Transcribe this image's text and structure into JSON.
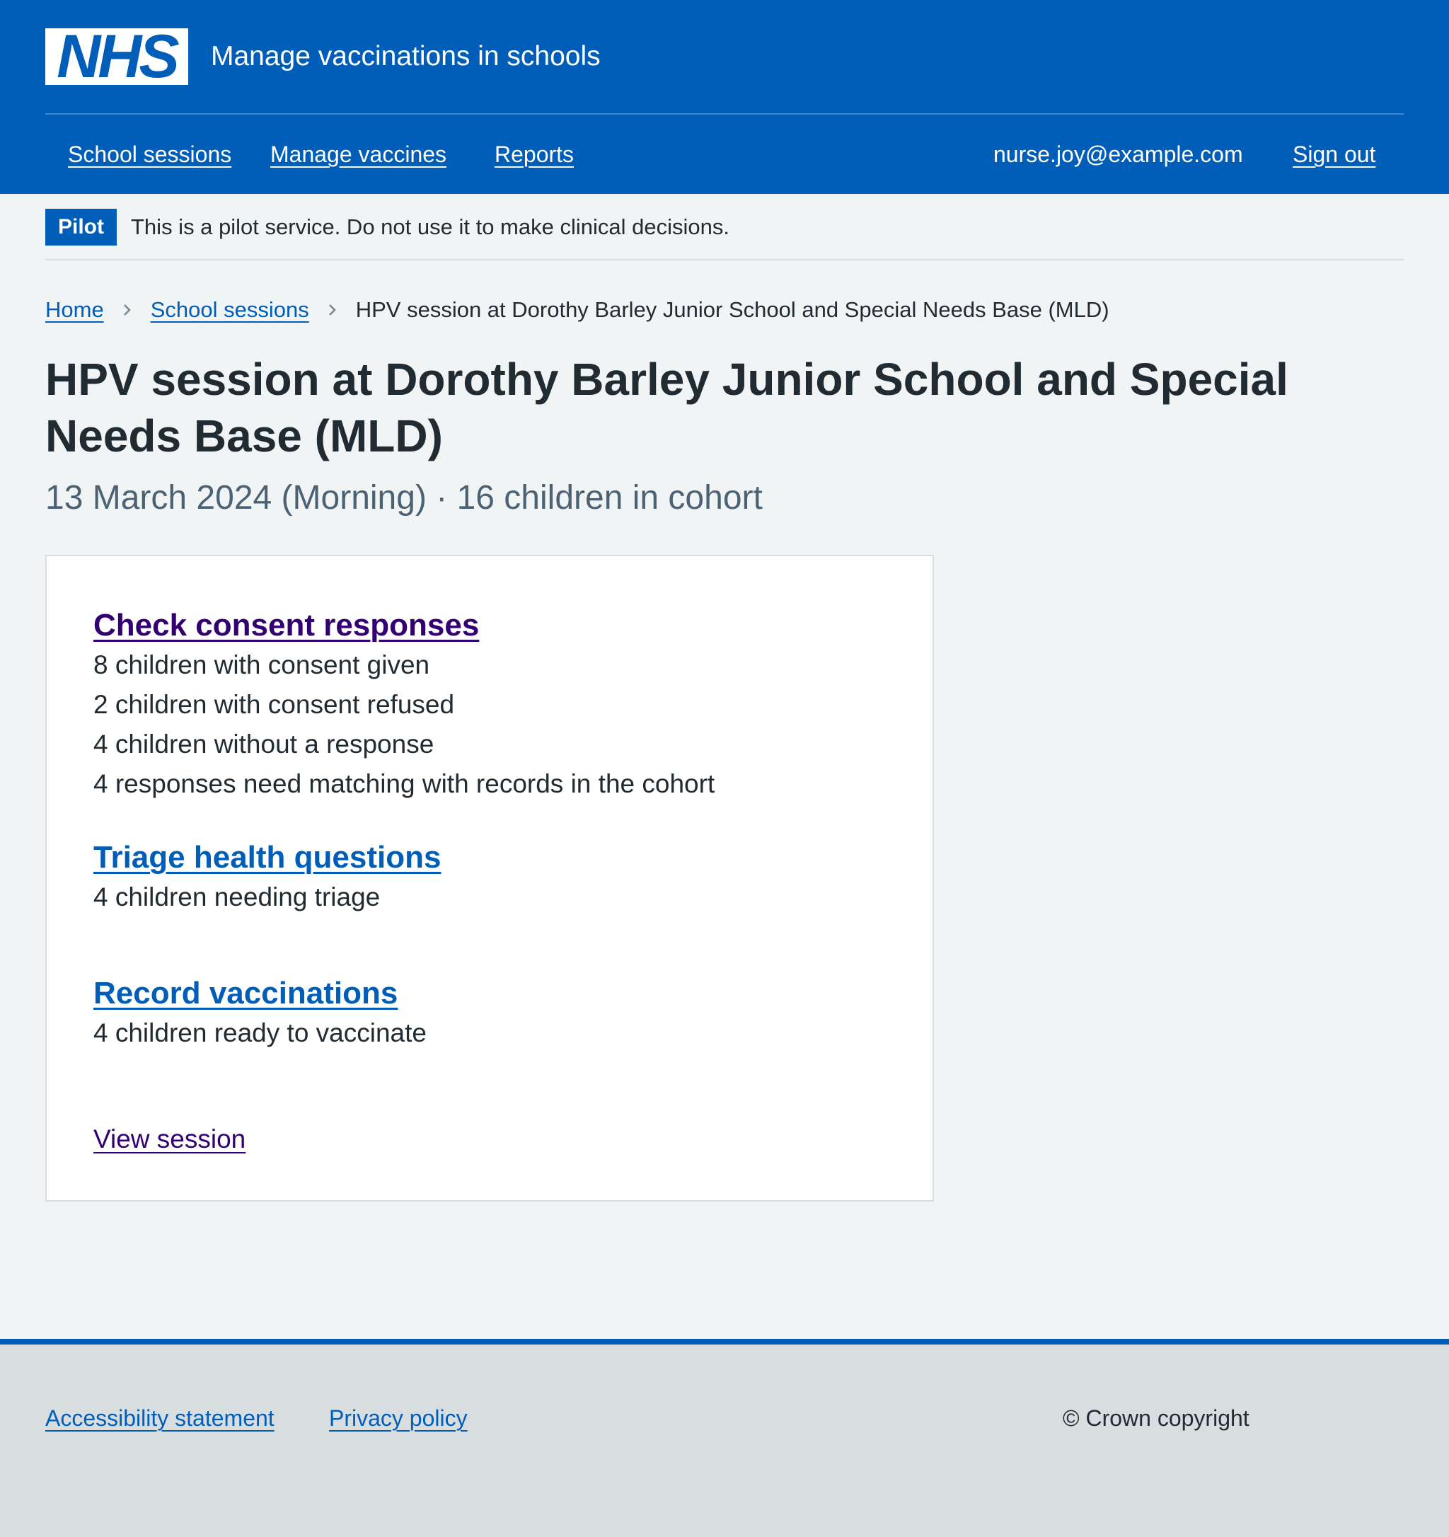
{
  "header": {
    "logo_text": "NHS",
    "service_name": "Manage vaccinations in schools",
    "nav": {
      "school_sessions": "School sessions",
      "manage_vaccines": "Manage vaccines",
      "reports": "Reports"
    },
    "user_email": "nurse.joy@example.com",
    "sign_out": "Sign out"
  },
  "pilot_banner": {
    "tag": "Pilot",
    "text": "This is a pilot service. Do not use it to make clinical decisions."
  },
  "breadcrumb": {
    "home": "Home",
    "school_sessions": "School sessions",
    "current": "HPV session at Dorothy Barley Junior School and Special Needs Base (MLD)"
  },
  "page": {
    "title": "HPV session at Dorothy Barley Junior School and Special Needs Base (MLD)",
    "caption": "13 March 2024 (Morning) · 16 children in cohort"
  },
  "card": {
    "consent": {
      "title": "Check consent responses",
      "lines": [
        "8 children with consent given",
        "2 children with consent refused",
        "4 children without a response",
        "4 responses need matching with records in the cohort"
      ]
    },
    "triage": {
      "title": "Triage health questions",
      "lines": [
        "4 children needing triage"
      ]
    },
    "record": {
      "title": "Record vaccinations",
      "lines": [
        "4 children ready to vaccinate"
      ]
    },
    "view_session": "View session"
  },
  "footer": {
    "accessibility": "Accessibility statement",
    "privacy": "Privacy policy",
    "copyright": "© Crown copyright"
  },
  "colors": {
    "nhs_blue": "#005eb8",
    "visited_link": "#330072",
    "background": "#f0f4f5",
    "text": "#212b32",
    "secondary_text": "#4c6272",
    "footer_bg": "#d8dde0"
  }
}
